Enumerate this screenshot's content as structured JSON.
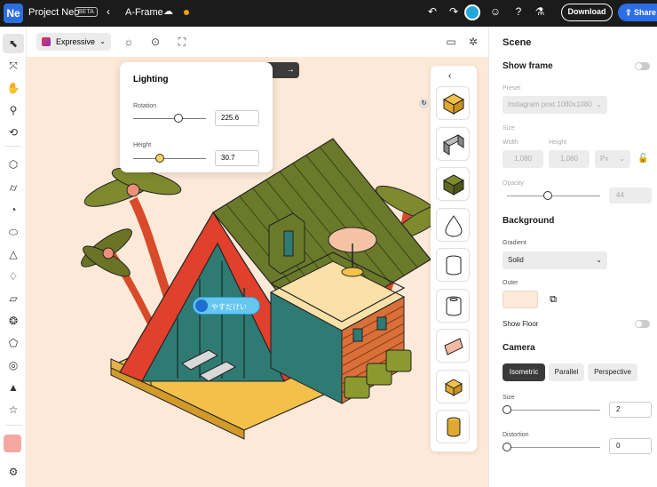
{
  "app": {
    "logo": "Ne",
    "name": "Project Neo",
    "badge": "BETA",
    "document": "A-Frame",
    "download_label": "Download",
    "share_label": "Share",
    "back_glyph": "‹",
    "cloud_glyph": "☁",
    "undo_glyph": "↶",
    "redo_glyph": "↷",
    "emoji_glyph": "☺",
    "help_glyph": "?",
    "lab_glyph": "⚗"
  },
  "toolbar": {
    "style_label": "Expressive",
    "chev": "⌄",
    "light_glyph": "☼",
    "camera_glyph": "⊙",
    "frame_glyph": "⛶",
    "kbd_glyph": "▭",
    "settings_glyph": "✲"
  },
  "tools": [
    {
      "name": "select-tool",
      "glyph": "⬉"
    },
    {
      "name": "direct-select-tool",
      "glyph": "⤧"
    },
    {
      "name": "pan-tool",
      "glyph": "✋"
    },
    {
      "name": "zoom-tool",
      "glyph": "⚲"
    },
    {
      "name": "orbit-tool",
      "glyph": "⟲"
    },
    {
      "name": "cube-tool",
      "glyph": "⬡"
    },
    {
      "name": "cylinder-tool",
      "glyph": "⌭"
    },
    {
      "name": "sphere-tool",
      "glyph": "◔"
    },
    {
      "name": "capsule-tool",
      "glyph": "⬭"
    },
    {
      "name": "cone-tool",
      "glyph": "△"
    },
    {
      "name": "drop-tool",
      "glyph": "♢"
    },
    {
      "name": "box-tool",
      "glyph": "▱"
    },
    {
      "name": "torus-knot-tool",
      "glyph": "❂"
    },
    {
      "name": "shape-tool",
      "glyph": "⬠"
    },
    {
      "name": "torus-tool",
      "glyph": "◎"
    },
    {
      "name": "pyramid-tool",
      "glyph": "▲"
    },
    {
      "name": "star-tool",
      "glyph": "☆"
    },
    {
      "name": "settings-tool",
      "glyph": "⚙"
    }
  ],
  "lighting": {
    "title": "Lighting",
    "rotation_label": "Rotation",
    "rotation_value": "225.6",
    "rotation_fraction": 0.62,
    "height_label": "Height",
    "height_value": "30.7",
    "height_fraction": 0.36
  },
  "canvas": {
    "next_glyph": "→",
    "label_text": "やすだけい"
  },
  "shapes_panel": {
    "collapse_glyph": "‹",
    "drag_glyph": "↻",
    "items": [
      "box",
      "arch",
      "cube",
      "teardrop",
      "cylinder",
      "tube",
      "wedge",
      "cube-small",
      "cylinder-gold"
    ]
  },
  "scene": {
    "title": "Scene",
    "show_frame_label": "Show frame",
    "preset_label": "Preset",
    "preset_value": "Instagram post 1080x1080",
    "size_label": "Size",
    "width_label": "Width",
    "height_label": "Height",
    "width_value": "1,080",
    "height_value": "1,060",
    "unit_value": "Px",
    "lock_glyph": "🔓",
    "opacity_label": "Opacity",
    "opacity_value": "44",
    "opacity_fraction": 0.44
  },
  "background": {
    "title": "Background",
    "gradient_label": "Gradient",
    "gradient_value": "Solid",
    "outer_label": "Outer",
    "outer_color": "#fde9d7",
    "picker_glyph": "⧉",
    "show_floor_label": "Show Floor"
  },
  "camera": {
    "title": "Camera",
    "modes": [
      "Isometric",
      "Parallel",
      "Perspective"
    ],
    "active_mode": "Isometric",
    "size_label": "Size",
    "size_value": "2",
    "size_fraction": 0.0,
    "distortion_label": "Distortion",
    "distortion_value": "0",
    "distortion_fraction": 0.0
  },
  "colors": {
    "accent": "#2c6ee5",
    "canvas_bg": "#fde9d7",
    "topbar": "#1b1b1b"
  }
}
